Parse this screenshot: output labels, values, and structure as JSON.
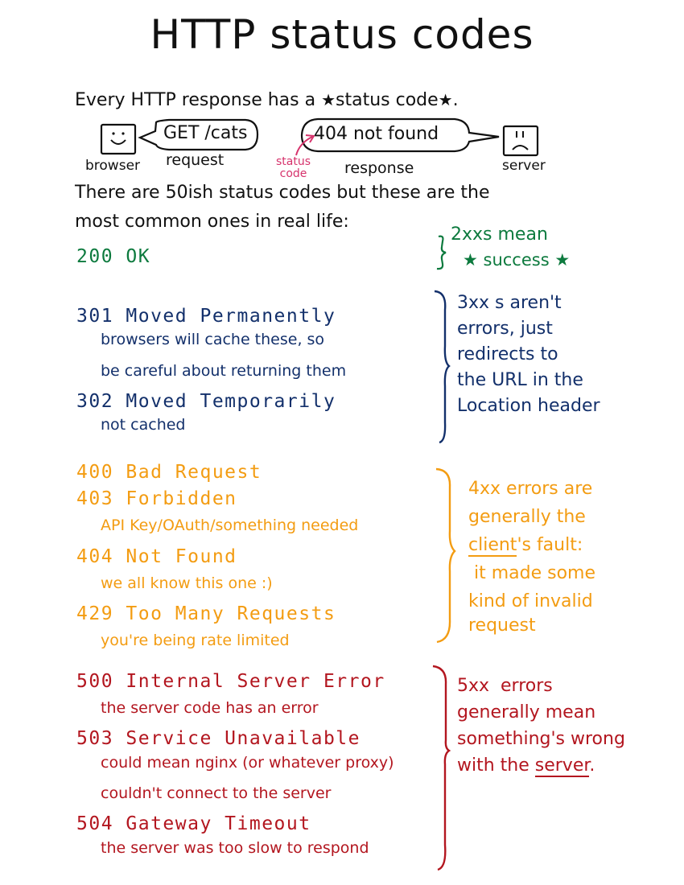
{
  "title": "HTTP status codes",
  "intro": {
    "before": "Every HTTP response has a ",
    "star_left": "★",
    "highlight": "status code",
    "star_right": "★",
    "after": "."
  },
  "diagram": {
    "browser_label": "browser",
    "request_text": "GET /cats",
    "request_label": "request",
    "response_text": "404 not found",
    "response_label": "response",
    "server_label": "server",
    "status_code_annotation": "status\ncode",
    "colors": {
      "annotation": "#d6336c"
    }
  },
  "paragraph": {
    "line1": "There are 50ish status codes but these are the",
    "line2": "most common ones in real life:"
  },
  "groups": [
    {
      "class": "2xx",
      "color": "#0d7a3e",
      "codes": [
        {
          "code": "200 OK",
          "desc": []
        }
      ],
      "note": {
        "line1": "2xxs mean",
        "line2": "★ success ★"
      }
    },
    {
      "class": "3xx",
      "color": "#13306b",
      "codes": [
        {
          "code": "301 Moved Permanently",
          "desc": [
            "browsers will cache these, so",
            "be careful about returning them"
          ]
        },
        {
          "code": "302 Moved Temporarily",
          "desc": [
            "not cached"
          ]
        }
      ],
      "note": {
        "lines": [
          "3xx s  aren't",
          "errors, just",
          "redirects to",
          "the URL in the",
          "Location header"
        ]
      }
    },
    {
      "class": "4xx",
      "color": "#f39c12",
      "codes": [
        {
          "code": "400 Bad Request",
          "desc": []
        },
        {
          "code": "403 Forbidden",
          "desc": [
            "API Key/OAuth/something needed"
          ]
        },
        {
          "code": "404 Not Found",
          "desc": [
            "we all know this one :)"
          ]
        },
        {
          "code": "429 Too Many Requests",
          "desc": [
            "you're being rate limited"
          ]
        }
      ],
      "note": {
        "line1": "4xx errors are",
        "line2": "generally the",
        "line3_underlined": "client",
        "line3_rest": "'s fault:",
        "line4": " it made some",
        "line5": "kind of invalid",
        "line6": "request"
      }
    },
    {
      "class": "5xx",
      "color": "#b3161f",
      "codes": [
        {
          "code": "500 Internal Server Error",
          "desc": [
            "the server code has an error"
          ]
        },
        {
          "code": "503 Service Unavailable",
          "desc": [
            "could mean nginx (or whatever proxy)",
            "couldn't connect to the server"
          ]
        },
        {
          "code": "504 Gateway Timeout",
          "desc": [
            "the server was too slow to respond"
          ]
        }
      ],
      "note": {
        "line1": "5xx  errors",
        "line2": "generally mean",
        "line3": "something's wrong",
        "line4_before": "with the ",
        "line4_underlined": "server",
        "line4_after": "."
      }
    }
  ]
}
